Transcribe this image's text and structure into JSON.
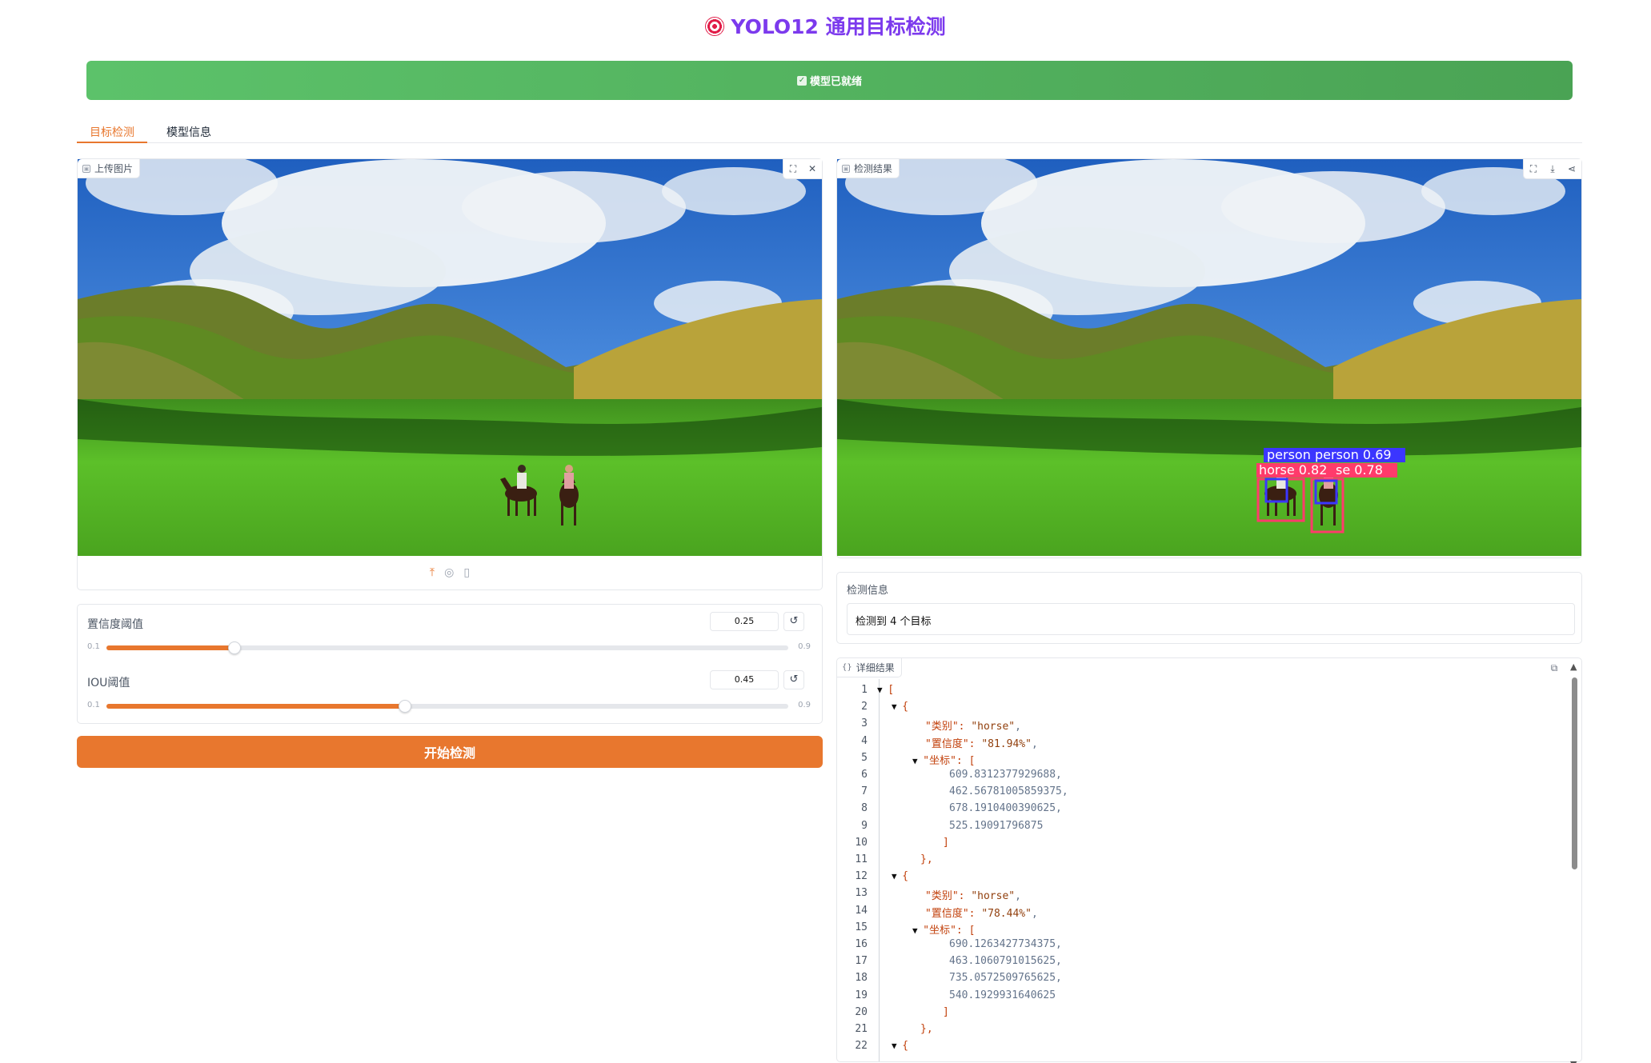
{
  "header": {
    "title": "YOLO12 通用目标检测"
  },
  "status": {
    "text": "模型已就绪"
  },
  "tabs": [
    {
      "label": "目标检测"
    },
    {
      "label": "模型信息"
    }
  ],
  "upload_panel": {
    "label": "上传图片"
  },
  "result_panel": {
    "label": "检测结果"
  },
  "conf_slider": {
    "label": "置信度阈值",
    "value": "0.25",
    "min": "0.1",
    "max": "0.9"
  },
  "iou_slider": {
    "label": "IOU阈值",
    "value": "0.45",
    "min": "0.1",
    "max": "0.9"
  },
  "run_button": {
    "label": "开始检测"
  },
  "detect_info": {
    "label": "检测信息",
    "text": "检测到 4 个目标"
  },
  "details": {
    "label": "详细结果"
  },
  "detection_labels": {
    "person_a": "person",
    "person_b": "person 0.69",
    "horse_a": "horse 0.82",
    "horse_b": "se 0.78"
  },
  "json_lines": [
    {
      "n": "1",
      "t": "▼ ",
      "code": "["
    },
    {
      "n": "2",
      "t": "▼ ",
      "code": "{"
    },
    {
      "n": "3",
      "key": "\"类别\": ",
      "str": "\"horse\"",
      "tail": ","
    },
    {
      "n": "4",
      "key": "\"置信度\": ",
      "str": "\"81.94%\"",
      "tail": ","
    },
    {
      "n": "5",
      "t": "▼ ",
      "key": "\"坐标\": ",
      "code": "["
    },
    {
      "n": "6",
      "num": "609.8312377929688,"
    },
    {
      "n": "7",
      "num": "462.56781005859375,"
    },
    {
      "n": "8",
      "num": "678.1910400390625,"
    },
    {
      "n": "9",
      "num": "525.19091796875"
    },
    {
      "n": "10",
      "code": "]"
    },
    {
      "n": "11",
      "code": "},"
    },
    {
      "n": "12",
      "t": "▼ ",
      "code": "{"
    },
    {
      "n": "13",
      "key": "\"类别\": ",
      "str": "\"horse\"",
      "tail": ","
    },
    {
      "n": "14",
      "key": "\"置信度\": ",
      "str": "\"78.44%\"",
      "tail": ","
    },
    {
      "n": "15",
      "t": "▼ ",
      "key": "\"坐标\": ",
      "code": "["
    },
    {
      "n": "16",
      "num": "690.1263427734375,"
    },
    {
      "n": "17",
      "num": "463.1060791015625,"
    },
    {
      "n": "18",
      "num": "735.0572509765625,"
    },
    {
      "n": "19",
      "num": "540.1929931640625"
    },
    {
      "n": "20",
      "code": "]"
    },
    {
      "n": "21",
      "code": "},"
    },
    {
      "n": "22",
      "t": "▼ ",
      "code": "{"
    }
  ]
}
